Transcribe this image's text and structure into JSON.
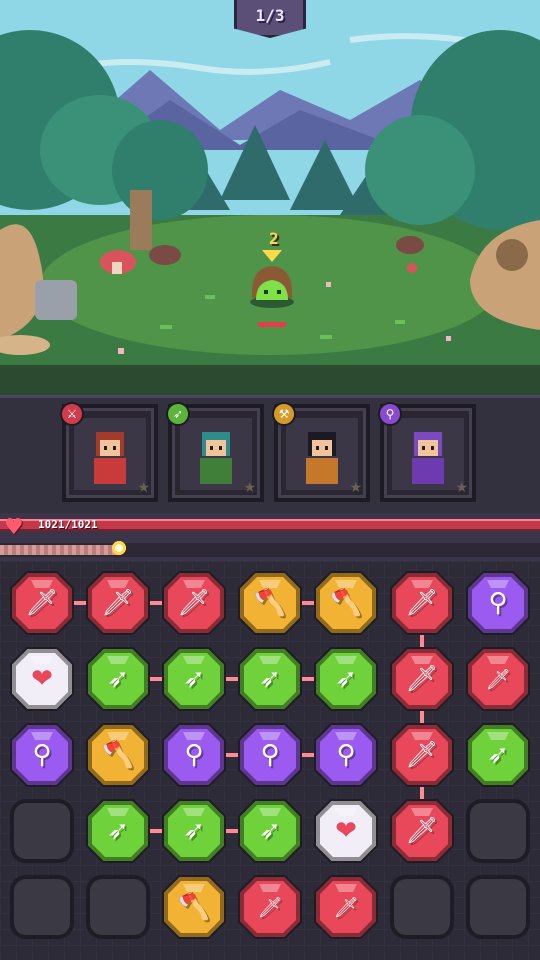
{
  "wave": {
    "label": "1/3"
  },
  "enemy": {
    "turn_counter": "2",
    "hp_fraction": 1.0
  },
  "party": {
    "hp_text": "1021/1021",
    "hp_fraction": 1.0,
    "charge_fraction": 0.22,
    "heroes": [
      {
        "name": "warrior",
        "class_icon": "sword-icon",
        "accent": "#d23b4c",
        "hair": "#a33b2a",
        "outfit": "#c93a3a"
      },
      {
        "name": "archer",
        "class_icon": "arrow-icon",
        "accent": "#5bb33a",
        "hair": "#2e8c8a",
        "outfit": "#3f7f3a"
      },
      {
        "name": "pirate",
        "class_icon": "axe-icon",
        "accent": "#d79a2a",
        "hair": "#1b1a22",
        "outfit": "#c6782a"
      },
      {
        "name": "mage",
        "class_icon": "staff-icon",
        "accent": "#8a4ad0",
        "hair": "#7c4ac0",
        "outfit": "#6e3ab0"
      }
    ]
  },
  "colors": {
    "red": "#e8485a",
    "green": "#6fd23b",
    "yellow": "#f2b233",
    "purple": "#9b5bf0",
    "white": "#f2eef8",
    "empty": "#3a3944"
  },
  "board": {
    "rows": [
      [
        "red-sword",
        "red-sword",
        "red-sword",
        "yellow-axe",
        "yellow-axe",
        "red-sword",
        "purple-staff"
      ],
      [
        "white-heart",
        "green-arrow",
        "green-arrow",
        "green-arrow",
        "green-arrow",
        "red-sword",
        "red-sword-small"
      ],
      [
        "purple-staff",
        "yellow-axe",
        "purple-staff",
        "purple-staff",
        "purple-staff",
        "red-sword",
        "green-arrow"
      ],
      [
        "empty",
        "green-arrow",
        "green-arrow",
        "green-arrow",
        "white-heart",
        "red-sword",
        "empty"
      ],
      [
        "empty",
        "empty",
        "yellow-axe",
        "red-sword-small",
        "red-sword-small",
        "empty",
        "empty"
      ]
    ],
    "glyphs": {
      "red-sword": "🗡",
      "red-sword-small": "🗡",
      "yellow-axe": "🪓",
      "green-arrow": "➶",
      "purple-staff": "⚲",
      "white-heart": "❤",
      "empty": ""
    }
  }
}
